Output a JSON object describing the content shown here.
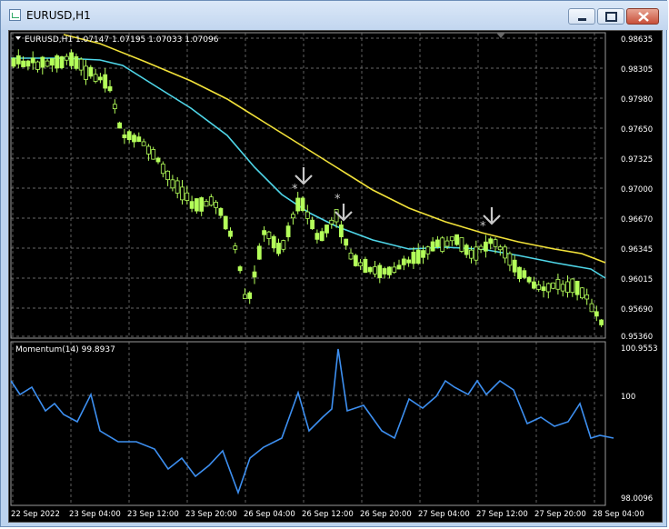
{
  "window": {
    "title": "EURUSD,H1"
  },
  "main_chart": {
    "header": "EURUSD,H1  1.07147 1.07195 1.07033 1.07096",
    "price_ticks": [
      "0.98635",
      "0.98305",
      "0.97980",
      "0.97650",
      "0.97325",
      "0.97000",
      "0.96670",
      "0.96345",
      "0.96015",
      "0.95690",
      "0.95360"
    ]
  },
  "indicator": {
    "header": "Momentum(14) 99.8937",
    "ticks": [
      "100.9553",
      "100",
      "98.0096"
    ]
  },
  "time_axis": {
    "labels": [
      "22 Sep 2022",
      "23 Sep 04:00",
      "23 Sep 12:00",
      "23 Sep 20:00",
      "26 Sep 04:00",
      "26 Sep 12:00",
      "26 Sep 20:00",
      "27 Sep 04:00",
      "27 Sep 12:00",
      "27 Sep 20:00",
      "28 Sep 04:00"
    ]
  },
  "colors": {
    "background": "#000000",
    "grid": "#8a8a8a",
    "candle": "#b4ff5a",
    "ma_fast": "#4fd6e8",
    "ma_slow": "#f2e23a",
    "momentum": "#3d8ff0",
    "arrow": "#c8c8c8"
  },
  "icons": {
    "minimize": "minimize-icon",
    "maximize": "maximize-icon",
    "close": "close-icon",
    "app": "chart-window-icon",
    "dropdown": "triangle-down-icon"
  }
}
